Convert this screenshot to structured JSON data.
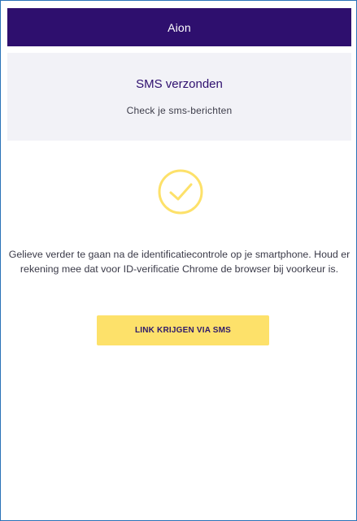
{
  "header": {
    "title": "Aion"
  },
  "notice": {
    "title": "SMS verzonden",
    "subtitle": "Check je sms-berichten"
  },
  "status": {
    "icon": "check-circle-icon",
    "color": "#fde16a"
  },
  "message": {
    "text": "Gelieve verder te gaan na de identificatiecontrole op je smartphone. Houd er rekening mee dat voor ID-verificatie Chrome de browser bij voorkeur is."
  },
  "actions": {
    "sms_button_label": "LINK KRIJGEN VIA SMS"
  },
  "colors": {
    "brand": "#2e0f6e",
    "accent": "#fde16a",
    "notice_bg": "#f2f2f7",
    "frame_border": "#2a73b8"
  }
}
